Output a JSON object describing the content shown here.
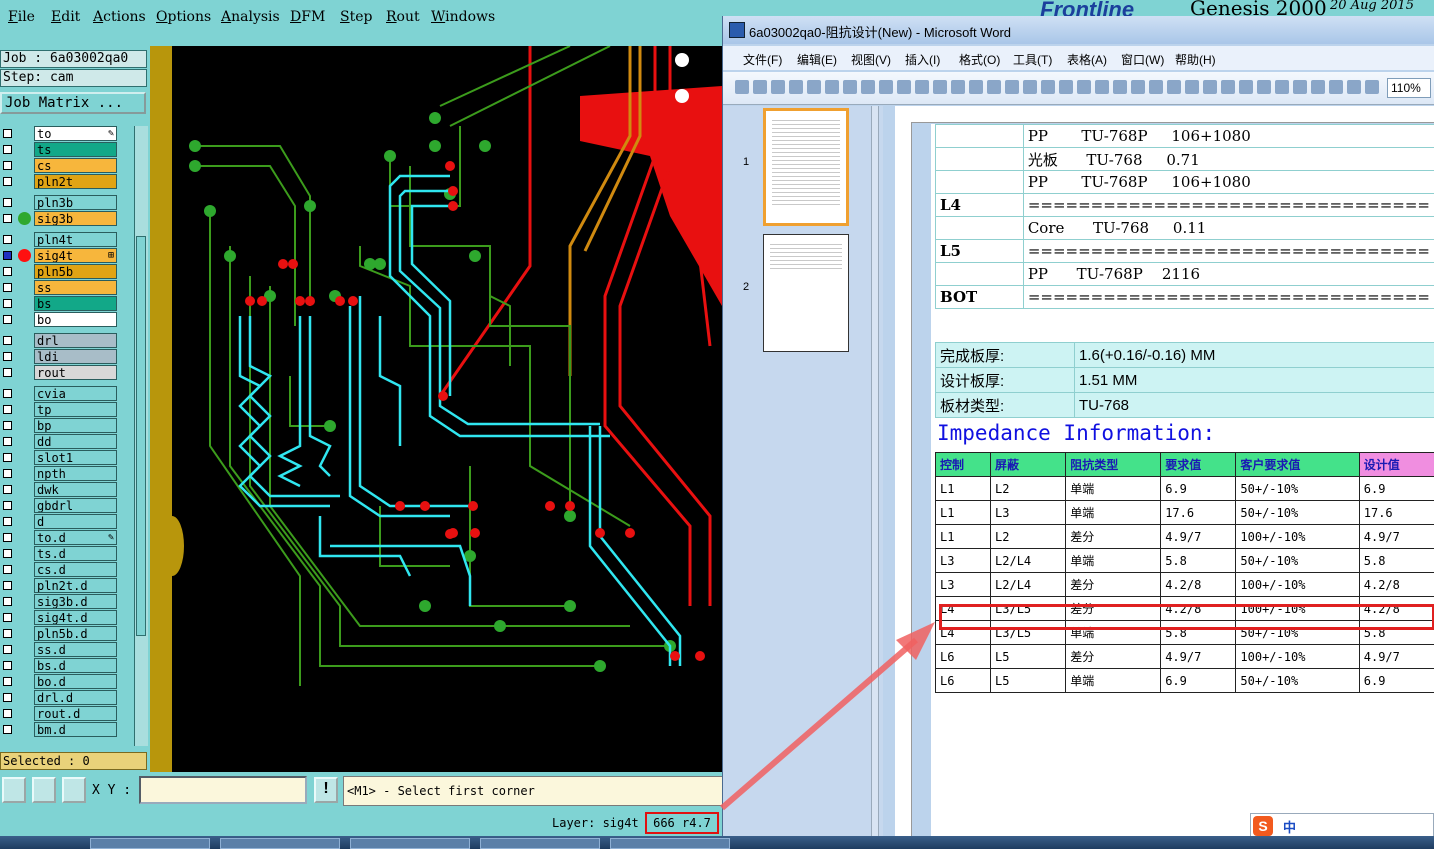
{
  "genesis": {
    "menu": [
      "File",
      "Edit",
      "Actions",
      "Options",
      "Analysis",
      "DFM",
      "Step",
      "Rout",
      "Windows"
    ],
    "logo_text": "Frontline",
    "product": "Genesis 2000",
    "date": "20 Aug 2015",
    "job": "Job :  6a03002qa0",
    "step": "Step:  cam",
    "job_matrix": "Job Matrix ...",
    "layers": [
      {
        "name": "to",
        "bg": "#ffffff",
        "mark": "✎"
      },
      {
        "name": "ts",
        "bg": "#12a888"
      },
      {
        "name": "cs",
        "bg": "#f7b63c"
      },
      {
        "name": "pln2t",
        "bg": "#e0a414"
      },
      {
        "name": "pln3b",
        "bg": "#7fd3d3",
        "gap": true
      },
      {
        "name": "sig3b",
        "bg": "#f7b63c",
        "dot": "#2fa82f"
      },
      {
        "name": "pln4t",
        "bg": "#7fd3d3",
        "gap": true
      },
      {
        "name": "sig4t",
        "bg": "#f7b63c",
        "dot": "#ff1010",
        "selected": true,
        "mark": "⊞"
      },
      {
        "name": "pln5b",
        "bg": "#e0a414"
      },
      {
        "name": "ss",
        "bg": "#f7b63c"
      },
      {
        "name": "bs",
        "bg": "#12a888"
      },
      {
        "name": "bo",
        "bg": "#ffffff"
      },
      {
        "name": "drl",
        "bg": "#a8bdc8",
        "gap": true
      },
      {
        "name": "ldi",
        "bg": "#a8bdc8"
      },
      {
        "name": "rout",
        "bg": "#d8d8d8"
      },
      {
        "name": "cvia",
        "bg": "#7fd3d3",
        "gap": true
      },
      {
        "name": "tp",
        "bg": "#7fd3d3"
      },
      {
        "name": "bp",
        "bg": "#7fd3d3"
      },
      {
        "name": "dd",
        "bg": "#7fd3d3"
      },
      {
        "name": "slot1",
        "bg": "#7fd3d3"
      },
      {
        "name": "npth",
        "bg": "#7fd3d3"
      },
      {
        "name": "dwk",
        "bg": "#7fd3d3"
      },
      {
        "name": "gbdrl",
        "bg": "#7fd3d3"
      },
      {
        "name": "d",
        "bg": "#7fd3d3"
      },
      {
        "name": "to.d",
        "bg": "#7fd3d3",
        "mark": "✎"
      },
      {
        "name": "ts.d",
        "bg": "#7fd3d3"
      },
      {
        "name": "cs.d",
        "bg": "#7fd3d3"
      },
      {
        "name": "pln2t.d",
        "bg": "#7fd3d3"
      },
      {
        "name": "sig3b.d",
        "bg": "#7fd3d3"
      },
      {
        "name": "sig4t.d",
        "bg": "#7fd3d3"
      },
      {
        "name": "pln5b.d",
        "bg": "#7fd3d3"
      },
      {
        "name": "ss.d",
        "bg": "#7fd3d3"
      },
      {
        "name": "bs.d",
        "bg": "#7fd3d3"
      },
      {
        "name": "bo.d",
        "bg": "#7fd3d3"
      },
      {
        "name": "drl.d",
        "bg": "#7fd3d3"
      },
      {
        "name": "rout.d",
        "bg": "#7fd3d3"
      },
      {
        "name": "bm.d",
        "bg": "#7fd3d3"
      }
    ],
    "selected": "Selected : 0",
    "xy_label": "X Y :",
    "message": "<M1> - Select first corner",
    "layer_status": "Layer: sig4t",
    "coord_status": "666 r4.7"
  },
  "word": {
    "title": "6a03002qa0-阻抗设计(New) - Microsoft Word",
    "menu": [
      "文件(F)",
      "编辑(E)",
      "视图(V)",
      "插入(I)",
      "格式(O)",
      "工具(T)",
      "表格(A)",
      "窗口(W)",
      "帮助(H)"
    ],
    "zoom": "110%",
    "thumb_pages": [
      "1",
      "2"
    ],
    "stack_rows": [
      [
        "",
        "PP       TU-768P     106+1080"
      ],
      [
        "",
        "光板      TU-768     0.71"
      ],
      [
        "",
        "PP       TU-768P     106+1080"
      ],
      [
        "L4",
        "================================"
      ],
      [
        "",
        "Core      TU-768     0.11"
      ],
      [
        "L5",
        "================================"
      ],
      [
        "",
        "PP      TU-768P    2116"
      ],
      [
        "BOT",
        "================================"
      ]
    ],
    "thickness": [
      [
        "完成板厚:",
        "1.6(+0.16/-0.16) MM"
      ],
      [
        "设计板厚:",
        "1.51 MM"
      ],
      [
        "板材类型:",
        "TU-768"
      ]
    ],
    "impedance_title": "Impedance Information:",
    "imp_headers": [
      "控制",
      "屏蔽",
      "阻抗类型",
      "要求值",
      "客户要求值",
      "设计值"
    ],
    "imp_rows": [
      [
        "L1",
        "L2",
        "单端",
        "6.9",
        "50+/-10%",
        "6.9"
      ],
      [
        "L1",
        "L3",
        "单端",
        "17.6",
        "50+/-10%",
        "17.6"
      ],
      [
        "L1",
        "L2",
        "差分",
        "4.9/7",
        "100+/-10%",
        "4.9/7"
      ],
      [
        "L3",
        "L2/L4",
        "单端",
        "5.8",
        "50+/-10%",
        "5.8"
      ],
      [
        "L3",
        "L2/L4",
        "差分",
        "4.2/8",
        "100+/-10%",
        "4.2/8"
      ],
      [
        "L4",
        "L3/L5",
        "差分",
        "4.2/8",
        "100+/-10%",
        "4.2/8"
      ],
      [
        "L4",
        "L3/L5",
        "单端",
        "5.8",
        "50+/-10%",
        "5.8"
      ],
      [
        "L6",
        "L5",
        "差分",
        "4.9/7",
        "100+/-10%",
        "4.9/7"
      ],
      [
        "L6",
        "L5",
        "单端",
        "6.9",
        "50+/-10%",
        "6.9"
      ]
    ],
    "ime": "中"
  }
}
